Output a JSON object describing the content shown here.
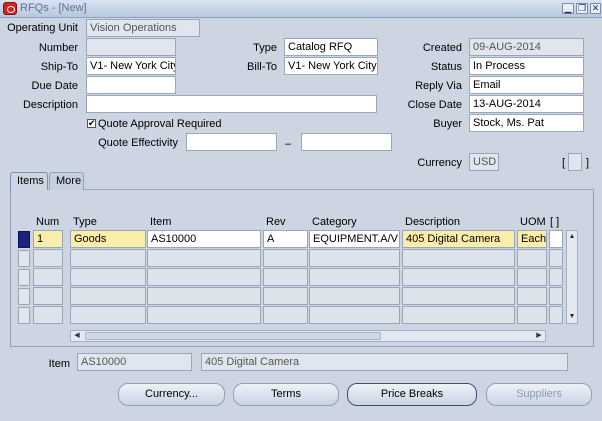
{
  "window": {
    "title": "RFQs - [New]",
    "minimize": "▁",
    "restore": "❐",
    "close": "✕"
  },
  "header": {
    "operating_unit_label": "Operating Unit",
    "operating_unit": "Vision Operations",
    "number_label": "Number",
    "number": "",
    "type_label": "Type",
    "type": "Catalog RFQ",
    "created_label": "Created",
    "created": "09-AUG-2014",
    "ship_to_label": "Ship-To",
    "ship_to": "V1- New York City",
    "bill_to_label": "Bill-To",
    "bill_to": "V1- New York City",
    "status_label": "Status",
    "status": "In Process",
    "due_date_label": "Due Date",
    "due_date": "",
    "reply_via_label": "Reply Via",
    "reply_via": "Email",
    "description_label": "Description",
    "description": "",
    "close_date_label": "Close Date",
    "close_date": "13-AUG-2014",
    "quote_approval_label": "Quote Approval Required",
    "quote_approval_mark": "✔",
    "buyer_label": "Buyer",
    "buyer": "Stock, Ms. Pat",
    "quote_effectivity_label": "Quote Effectivity",
    "quote_effectivity_dash": "–",
    "currency_label": "Currency",
    "currency": "USD",
    "dff_open": "[",
    "dff_close": "]"
  },
  "tabs": [
    {
      "label": "Items"
    },
    {
      "label": "More"
    }
  ],
  "lines": {
    "columns": {
      "num": "Num",
      "type": "Type",
      "item": "Item",
      "rev": "Rev",
      "category": "Category",
      "description": "Description",
      "uom": "UOM",
      "dff": "[ ]"
    },
    "rows": [
      {
        "num": "1",
        "type": "Goods",
        "item": "AS10000",
        "rev": "A",
        "category": "EQUIPMENT.A/V",
        "description": "405 Digital Camera",
        "uom": "Each"
      }
    ]
  },
  "footer": {
    "item_label": "Item",
    "item": "AS10000",
    "item_description": "405 Digital Camera"
  },
  "buttons": {
    "currency": "Currency...",
    "terms": "Terms",
    "price_breaks": "Price Breaks",
    "suppliers": "Suppliers"
  }
}
